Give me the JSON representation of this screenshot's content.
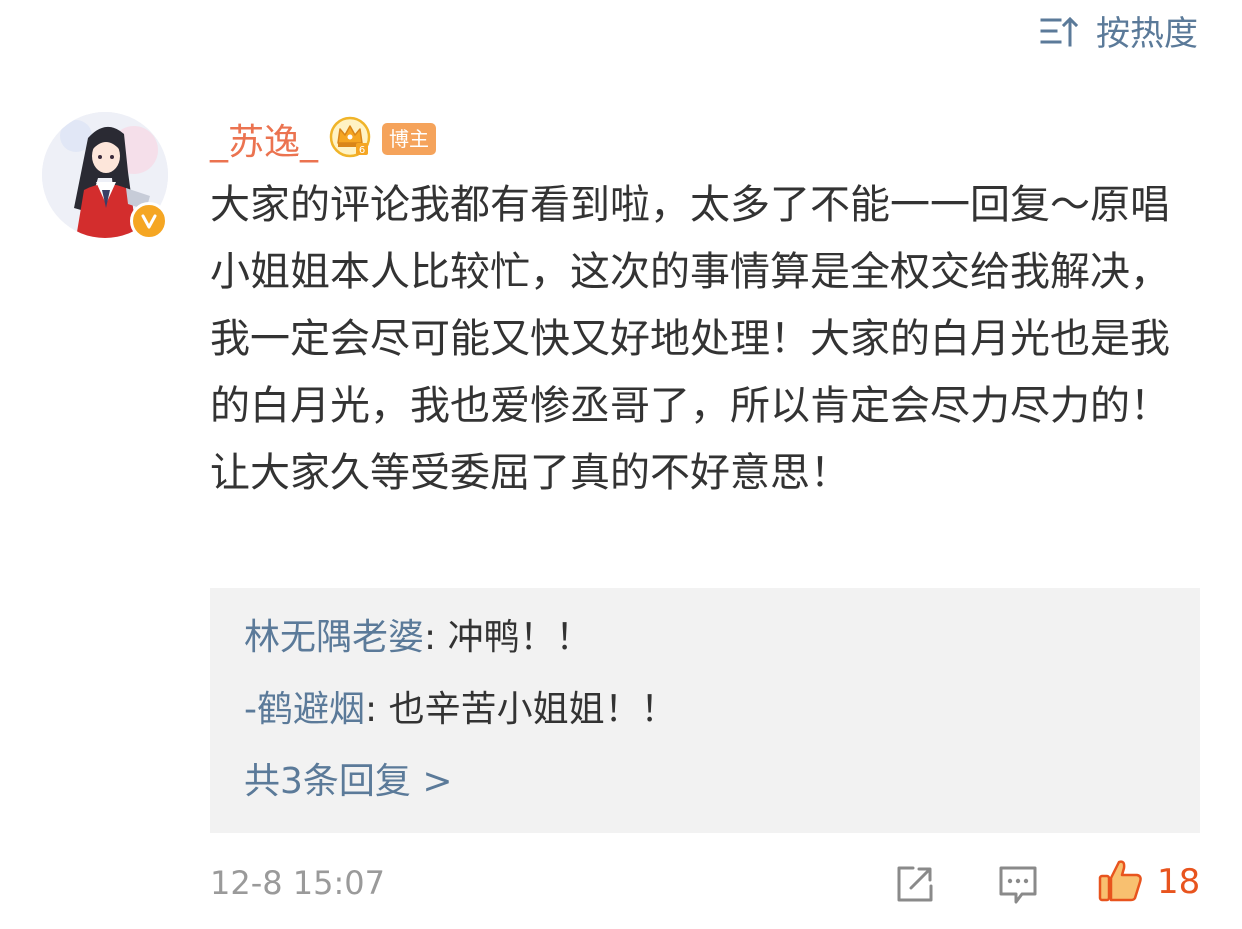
{
  "sort": {
    "icon": "sort-icon",
    "label": "按热度"
  },
  "comment": {
    "avatar_icon": "avatar",
    "verified_icon": "verified-v-icon",
    "username": "_苏逸_",
    "vip_icon": "crown-vip-icon",
    "badge": "博主",
    "text": "大家的评论我都有看到啦，太多了不能一一回复～原唱小姐姐本人比较忙，这次的事情算是全权交给我解决，我一定会尽可能又快又好地处理！大家的白月光也是我的白月光，我也爱惨丞哥了，所以肯定会尽力尽力的！让大家久等受委屈了真的不好意思！",
    "timestamp": "12-8 15:07",
    "like_count": "18"
  },
  "replies": [
    {
      "user": "林无隅老婆",
      "text": ": 冲鸭！！"
    },
    {
      "user": "-鹤避烟",
      "text": ": 也辛苦小姐姐！！"
    }
  ],
  "more_replies": "共3条回复 >",
  "actions": {
    "forward_icon": "share-forward-icon",
    "reply_icon": "comment-reply-icon",
    "like_icon": "thumbs-up-icon"
  },
  "colors": {
    "username": "#eb7350",
    "link": "#5b7a99",
    "text": "#333333",
    "muted": "#9a9a9a",
    "like": "#e8541e",
    "reply_bg": "#f2f2f2",
    "badge": "#f5a35b",
    "verified": "#f5a623"
  }
}
